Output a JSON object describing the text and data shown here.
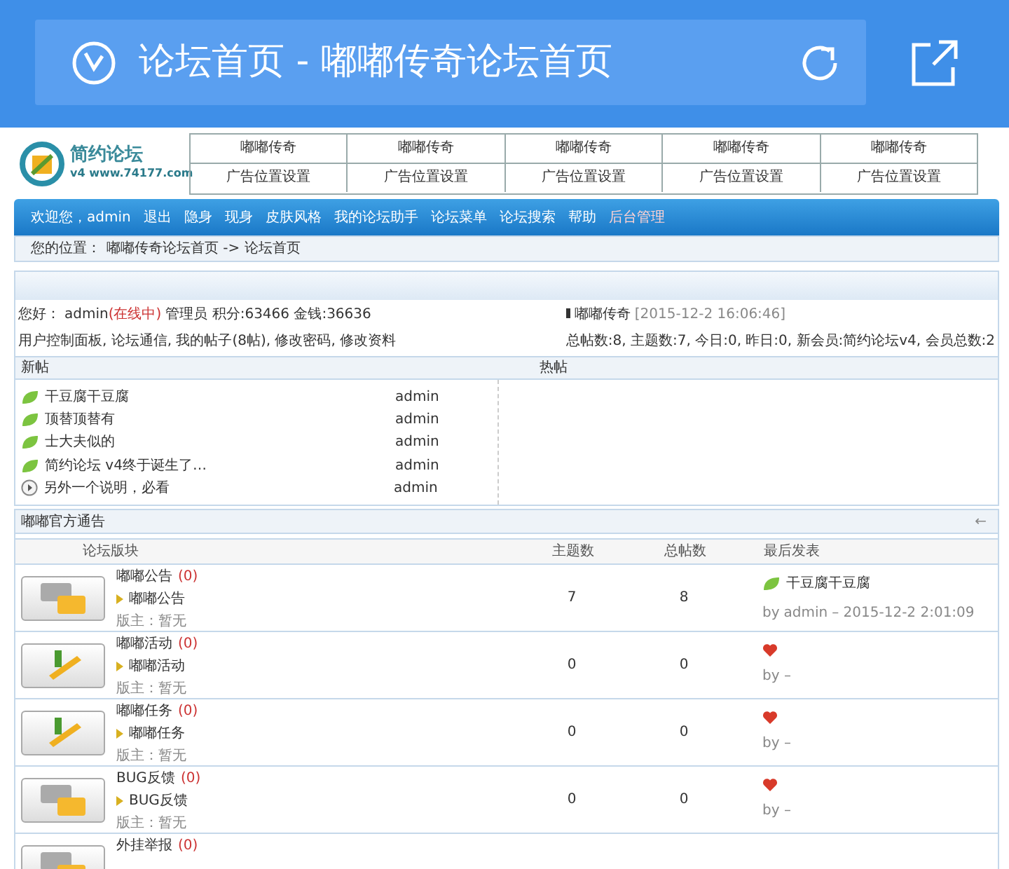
{
  "browser": {
    "title": "论坛首页 - 嘟嘟传奇论坛首页"
  },
  "logo": {
    "name": "简约论坛",
    "site": "v4 www.74177.com"
  },
  "ad_grid": [
    [
      "嘟嘟传奇",
      "嘟嘟传奇",
      "嘟嘟传奇",
      "嘟嘟传奇",
      "嘟嘟传奇"
    ],
    [
      "广告位置设置",
      "广告位置设置",
      "广告位置设置",
      "广告位置设置",
      "广告位置设置"
    ]
  ],
  "nav": [
    {
      "label": "欢迎您，admin",
      "kind": "text"
    },
    {
      "label": "退出",
      "kind": "link"
    },
    {
      "label": "隐身",
      "kind": "link"
    },
    {
      "label": "现身",
      "kind": "link"
    },
    {
      "label": "皮肤风格",
      "kind": "link"
    },
    {
      "label": "我的论坛助手",
      "kind": "link"
    },
    {
      "label": "论坛菜单",
      "kind": "link"
    },
    {
      "label": "论坛搜索",
      "kind": "link"
    },
    {
      "label": "帮助",
      "kind": "link"
    },
    {
      "label": "后台管理",
      "kind": "highlight"
    }
  ],
  "breadcrumb": {
    "label": "您的位置：",
    "path": "嘟嘟传奇论坛首页 -> 论坛首页"
  },
  "user_info": {
    "greeting": "您好：",
    "username": "admin",
    "status": "(在线中)",
    "details": "管理员 积分:63466 金钱:36636",
    "links": "用户控制面板, 论坛通信, 我的帖子(8帖), 修改密码, 修改资料"
  },
  "forum_info": {
    "name": "嘟嘟传奇",
    "time": "[2015-12-2 16:06:46]",
    "stats": "总帖数:8, 主题数:7, 今日:0, 昨日:0, 新会员:简约论坛v4, 会员总数:2"
  },
  "tabs": [
    "新帖",
    "热帖"
  ],
  "new_posts": [
    {
      "title": "干豆腐干豆腐",
      "author": "admin",
      "kind": "leaf"
    },
    {
      "title": "顶替顶替有",
      "author": "admin",
      "kind": "leaf"
    },
    {
      "title": "士大夫似的",
      "author": "admin",
      "kind": "leaf"
    },
    {
      "title": "简约论坛 v4终于诞生了…",
      "author": "admin",
      "kind": "leaf"
    },
    {
      "title": "另外一个说明，必看",
      "author": "admin",
      "kind": "notice"
    }
  ],
  "section": {
    "title": "嘟嘟官方通告",
    "toggle": "←"
  },
  "columns": [
    "论坛版块",
    "主题数",
    "总帖数",
    "最后发表"
  ],
  "boards": [
    {
      "kind": "chat",
      "name": "嘟嘟公告",
      "count": "(0)",
      "sub": "嘟嘟公告",
      "moderator": "版主：暂无",
      "topics": "7",
      "posts": "8",
      "last": {
        "kind": "post",
        "title": "干豆腐干豆腐",
        "by": "by",
        "user": "admin",
        "time": "– 2015-12-2 2:01:09"
      }
    },
    {
      "kind": "pencil",
      "name": "嘟嘟活动",
      "count": "(0)",
      "sub": "嘟嘟活动",
      "moderator": "版主：暂无",
      "topics": "0",
      "posts": "0",
      "last": {
        "kind": "none",
        "by": "by –"
      }
    },
    {
      "kind": "pencil",
      "name": "嘟嘟任务",
      "count": "(0)",
      "sub": "嘟嘟任务",
      "moderator": "版主：暂无",
      "topics": "0",
      "posts": "0",
      "last": {
        "kind": "none",
        "by": "by –"
      }
    },
    {
      "kind": "chat",
      "name": "BUG反馈",
      "count": "(0)",
      "sub": "BUG反馈",
      "moderator": "版主：暂无",
      "topics": "0",
      "posts": "0",
      "last": {
        "kind": "none",
        "by": "by –"
      }
    },
    {
      "kind": "chat",
      "name": "外挂举报",
      "count": "(0)"
    }
  ]
}
